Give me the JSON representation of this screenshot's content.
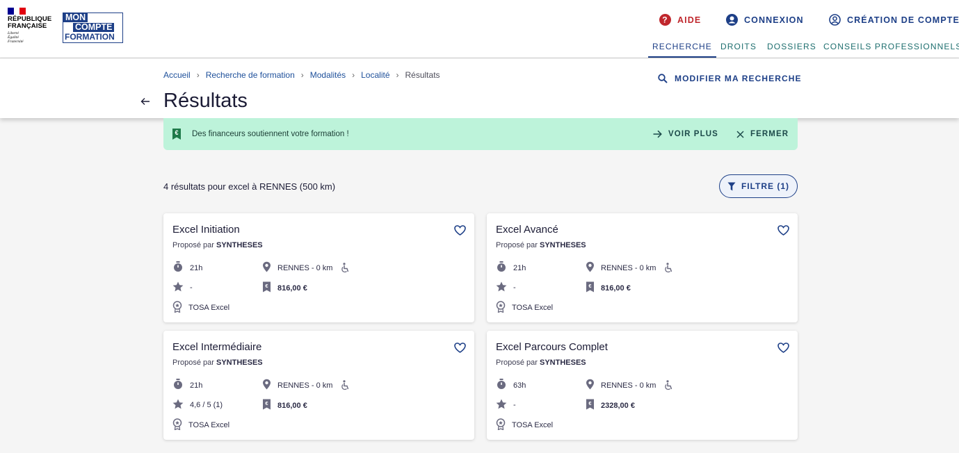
{
  "header": {
    "republique": "RÉPUBLIQUE\nFRANÇAISE",
    "motto": "Liberté\nÉgalité\nFraternité",
    "logo": {
      "line1": "MON",
      "line2": "COMPTE",
      "line3": "FORMATION"
    },
    "links": {
      "aide": "AIDE",
      "connexion": "CONNEXION",
      "creation": "CRÉATION DE COMPTE"
    },
    "nav": [
      "RECHERCHE",
      "DROITS",
      "DOSSIERS",
      "CONSEILS PROFESSIONNELS"
    ],
    "colors": {
      "brand": "#1d3f87",
      "aide": "#c0272d",
      "nav": "#1d6e6e"
    }
  },
  "breadcrumb": [
    "Accueil",
    "Recherche de formation",
    "Modalités",
    "Localité",
    "Résultats"
  ],
  "page_title": "Résultats",
  "modify_search": "MODIFIER MA RECHERCHE",
  "banner": {
    "text": "Des financeurs soutiennent votre formation !",
    "more": "VOIR PLUS",
    "close": "FERMER",
    "bg": "#bdf3da"
  },
  "results": {
    "count_text": "4 résultats pour excel à RENNES (500 km)",
    "filter_label": "FILTRE (1)"
  },
  "cards": [
    {
      "title": "Excel Initiation",
      "proposed": "Proposé par",
      "org": "SYNTHESES",
      "duration": "21h",
      "location": "RENNES - 0 km",
      "rating": "-",
      "price": "816,00 €",
      "cert": "TOSA Excel"
    },
    {
      "title": "Excel Avancé",
      "proposed": "Proposé par",
      "org": "SYNTHESES",
      "duration": "21h",
      "location": "RENNES - 0 km",
      "rating": "-",
      "price": "816,00 €",
      "cert": "TOSA Excel"
    },
    {
      "title": "Excel Intermédiaire",
      "proposed": "Proposé par",
      "org": "SYNTHESES",
      "duration": "21h",
      "location": "RENNES - 0 km",
      "rating": "4,6 / 5 (1)",
      "price": "816,00 €",
      "cert": "TOSA Excel"
    },
    {
      "title": "Excel Parcours Complet",
      "proposed": "Proposé par",
      "org": "SYNTHESES",
      "duration": "63h",
      "location": "RENNES - 0 km",
      "rating": "-",
      "price": "2328,00 €",
      "cert": "TOSA Excel"
    }
  ]
}
